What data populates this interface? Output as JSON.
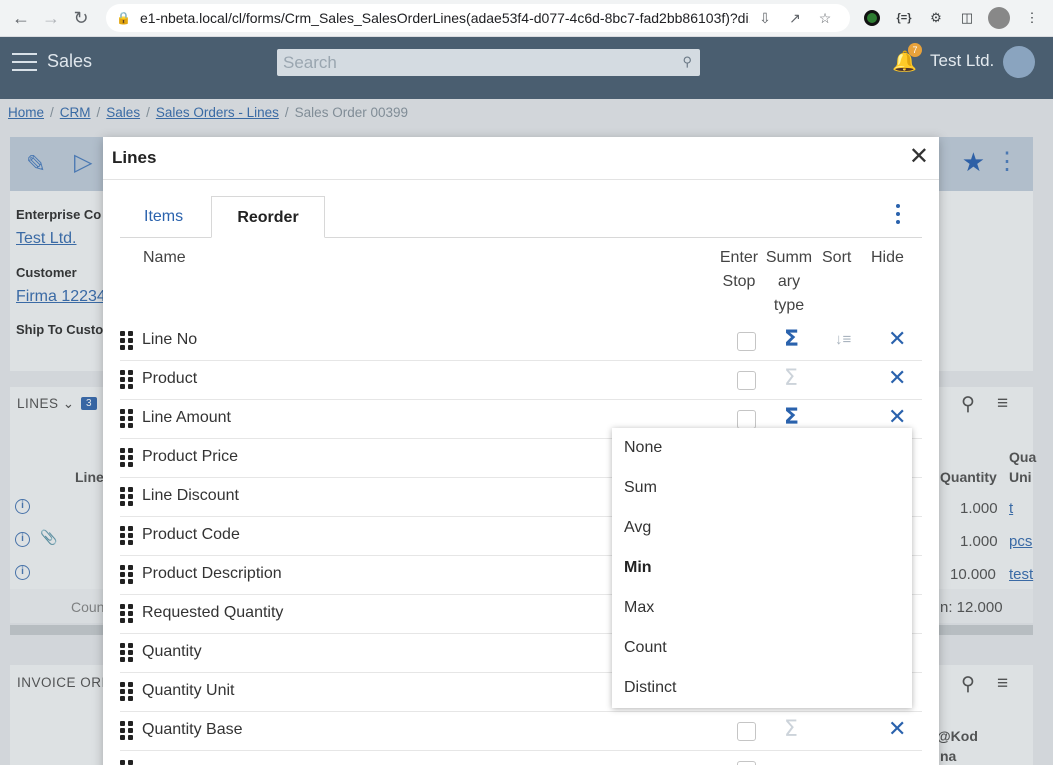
{
  "browser": {
    "url": "e1-nbeta.local/cl/forms/Crm_Sales_SalesOrderLines(adae53f4-d077-4c6d-8bc7-fad2bb86103f)?di...",
    "icons": [
      "back-icon",
      "forward-icon",
      "reload-icon",
      "lock-icon",
      "download-icon",
      "share-icon",
      "star-icon",
      "extension-icon",
      "puzzle-icon",
      "side-panel-icon",
      "profile-icon",
      "menu-icon"
    ]
  },
  "app": {
    "title": "Sales",
    "search_placeholder": "Search",
    "notifications_count": "7",
    "company": "Test Ltd."
  },
  "breadcrumb": {
    "items": [
      "Home",
      "CRM",
      "Sales",
      "Sales Orders - Lines"
    ],
    "current": "Sales Order 00399"
  },
  "background": {
    "enterprise_label": "Enterprise Co",
    "enterprise_value": "Test Ltd.",
    "customer_label": "Customer",
    "customer_value": "Firma 12234",
    "ship_to_label": "Ship To Custo",
    "lines_title": "LINES",
    "lines_count": "3",
    "col_line": "Line",
    "col_quantity": "Quantity",
    "col_qua": "Qua",
    "col_uni": "Uni",
    "rows": [
      {
        "qty": "1.000",
        "unit": "t"
      },
      {
        "qty": "1.000",
        "unit": "pcs"
      },
      {
        "qty": "10.000",
        "unit": "test"
      }
    ],
    "count_label": "Coun",
    "sum_label": "n: 12.000",
    "invoice_title": "INVOICE ORI",
    "kod_label": "@Kod",
    "na_label": "na"
  },
  "dialog": {
    "title": "Lines",
    "tabs": [
      "Items",
      "Reorder"
    ],
    "active_tab": "Reorder",
    "columns": {
      "name": "Name",
      "enter_stop_1": "Enter",
      "enter_stop_2": "Stop",
      "summary_1": "Summ",
      "summary_2": "ary",
      "summary_3": "type",
      "sort": "Sort",
      "hide": "Hide"
    },
    "rows": [
      {
        "label": "Line No"
      },
      {
        "label": "Product"
      },
      {
        "label": "Line Amount"
      },
      {
        "label": "Product Price"
      },
      {
        "label": "Line Discount"
      },
      {
        "label": "Product Code"
      },
      {
        "label": "Product Description"
      },
      {
        "label": "Requested Quantity"
      },
      {
        "label": "Quantity"
      },
      {
        "label": "Quantity Unit"
      },
      {
        "label": "Quantity Base"
      }
    ]
  },
  "summary_dropdown": {
    "options": [
      "None",
      "Sum",
      "Avg",
      "Min",
      "Max",
      "Count",
      "Distinct"
    ],
    "selected": "Min"
  },
  "colors": {
    "accent": "#2a62ad",
    "appbar": "#4a5e70",
    "badge": "#e8a23b"
  }
}
